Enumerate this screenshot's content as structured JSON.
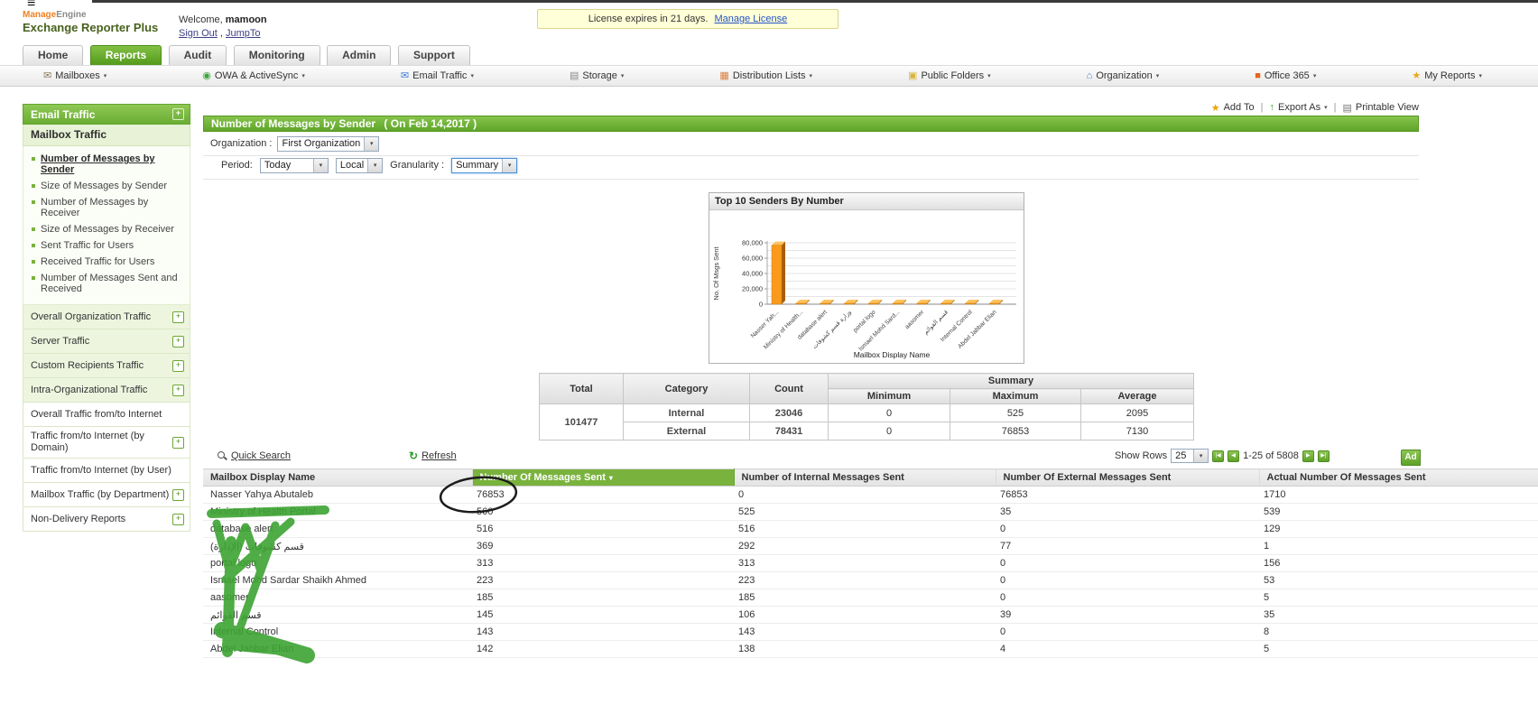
{
  "chrome": {
    "hamburger": "≡"
  },
  "header": {
    "brand_manage": "Manage",
    "brand_engine": "Engine",
    "product": "Exchange Reporter Plus",
    "welcome_prefix": "Welcome,",
    "username": "mamoon",
    "sign_out": "Sign Out",
    "comma": ",",
    "jump_to": "JumpTo",
    "license_text": "License expires in 21 days.",
    "license_link": "Manage License"
  },
  "tabs": [
    {
      "label": "Home",
      "active": false
    },
    {
      "label": "Reports",
      "active": true
    },
    {
      "label": "Audit",
      "active": false
    },
    {
      "label": "Monitoring",
      "active": false
    },
    {
      "label": "Admin",
      "active": false
    },
    {
      "label": "Support",
      "active": false
    }
  ],
  "nav_items": [
    {
      "label": "Mailboxes",
      "icon": "mailboxes-icon",
      "glyph": "✉",
      "color": "#8a7b5c"
    },
    {
      "label": "OWA & ActiveSync",
      "icon": "owa-activesync-icon",
      "glyph": "◉",
      "color": "#3fa43f"
    },
    {
      "label": "Email Traffic",
      "icon": "email-traffic-icon",
      "glyph": "✉",
      "color": "#3f7fd9"
    },
    {
      "label": "Storage",
      "icon": "storage-icon",
      "glyph": "▤",
      "color": "#8a8a8a"
    },
    {
      "label": "Distribution Lists",
      "icon": "distribution-lists-icon",
      "glyph": "▦",
      "color": "#d9823f"
    },
    {
      "label": "Public Folders",
      "icon": "public-folders-icon",
      "glyph": "▣",
      "color": "#d9b43f"
    },
    {
      "label": "Organization",
      "icon": "organization-icon",
      "glyph": "⌂",
      "color": "#3f7fd9"
    },
    {
      "label": "Office 365",
      "icon": "office-365-icon",
      "glyph": "■",
      "color": "#e8641b"
    },
    {
      "label": "My Reports",
      "icon": "my-reports-icon",
      "glyph": "★",
      "color": "#e8a81b"
    }
  ],
  "sidebar": {
    "header": "Email Traffic",
    "group": "Mailbox Traffic",
    "items": [
      {
        "label": "Number of Messages by Sender",
        "active": true
      },
      {
        "label": "Size of Messages by Sender",
        "active": false
      },
      {
        "label": "Number of Messages by Receiver",
        "active": false
      },
      {
        "label": "Size of Messages by Receiver",
        "active": false
      },
      {
        "label": "Sent Traffic for Users",
        "active": false
      },
      {
        "label": "Received Traffic for Users",
        "active": false
      },
      {
        "label": "Number of Messages Sent and Received",
        "active": false
      }
    ],
    "sections": [
      {
        "label": "Overall Organization Traffic",
        "tint": true,
        "expand": true
      },
      {
        "label": "Server Traffic",
        "tint": true,
        "expand": true
      },
      {
        "label": "Custom Recipients Traffic",
        "tint": true,
        "expand": true
      },
      {
        "label": "Intra-Organizational Traffic",
        "tint": true,
        "expand": true
      },
      {
        "label": "Overall Traffic from/to Internet",
        "tint": false,
        "expand": false
      },
      {
        "label": "Traffic from/to Internet (by Domain)",
        "tint": false,
        "expand": true
      },
      {
        "label": "Traffic from/to Internet (by User)",
        "tint": false,
        "expand": false
      },
      {
        "label": "Mailbox Traffic (by Department)",
        "tint": false,
        "expand": true
      },
      {
        "label": "Non-Delivery Reports",
        "tint": false,
        "expand": true
      }
    ]
  },
  "actions": {
    "add_to": "Add To",
    "export_as": "Export As",
    "printable_view": "Printable View",
    "sep": "|"
  },
  "report": {
    "title": "Number of Messages by Sender",
    "date": "( On Feb 14,2017 )",
    "organization_label": "Organization :",
    "organization_value": "First Organization",
    "period_label": "Period:",
    "period_value": "Today",
    "tz_value": "Local",
    "granularity_label": "Granularity :",
    "granularity_value": "Summary"
  },
  "chart_data": {
    "type": "bar",
    "title": "Top 10 Senders By Number",
    "xlabel": "Mailbox Display Name",
    "ylabel": "No. Of Msgs Sent",
    "ylim": [
      0,
      80000
    ],
    "yticks": [
      0,
      20000,
      40000,
      60000,
      80000
    ],
    "grid": true,
    "legend": "none",
    "categories": [
      "Nasser Yah...",
      "Ministry of Health...",
      "database alert",
      "وزارة قسم كشوفات",
      "portal logo",
      "Ismael Mohd Sard...",
      "aasomer",
      "قسم القوائم",
      "Internal Control",
      "Abdel Jabbar Elian"
    ],
    "values": [
      76853,
      560,
      516,
      369,
      313,
      223,
      185,
      145,
      143,
      142
    ]
  },
  "summary_table": {
    "headers": {
      "total": "Total",
      "category": "Category",
      "count": "Count",
      "summary": "Summary",
      "minimum": "Minimum",
      "maximum": "Maximum",
      "average": "Average"
    },
    "total": "101477",
    "rows": [
      {
        "category": "Internal",
        "count": "23046",
        "min": "0",
        "max": "525",
        "avg": "2095"
      },
      {
        "category": "External",
        "count": "78431",
        "min": "0",
        "max": "76853",
        "avg": "7130"
      }
    ]
  },
  "toolbar": {
    "quick_search": "Quick Search",
    "refresh": "Refresh",
    "show_rows_label": "Show Rows",
    "show_rows_value": "25",
    "range": "1-25 of 5808",
    "add_cut": "Ad"
  },
  "table": {
    "columns": [
      "Mailbox Display Name",
      "Number Of Messages Sent",
      "Number of Internal Messages Sent",
      "Number Of External Messages Sent",
      "Actual Number Of Messages Sent"
    ],
    "rows": [
      {
        "name": "Nasser Yahya Abutaleb",
        "sent": "76853",
        "internal": "0",
        "external": "76853",
        "actual": "1710"
      },
      {
        "name": "Ministry of Health Portal",
        "sent": "560",
        "internal": "525",
        "external": "35",
        "actual": "539"
      },
      {
        "name": "database alert",
        "sent": "516",
        "internal": "516",
        "external": "0",
        "actual": "129"
      },
      {
        "name": "قسم كشوفات (الإدارة)",
        "sent": "369",
        "internal": "292",
        "external": "77",
        "actual": "1"
      },
      {
        "name": "portal logo",
        "sent": "313",
        "internal": "313",
        "external": "0",
        "actual": "156"
      },
      {
        "name": "Ismael Mohd Sardar Shaikh Ahmed",
        "sent": "223",
        "internal": "223",
        "external": "0",
        "actual": "53"
      },
      {
        "name": "aasomer",
        "sent": "185",
        "internal": "185",
        "external": "0",
        "actual": "5"
      },
      {
        "name": "قسم القوائم",
        "sent": "145",
        "internal": "106",
        "external": "39",
        "actual": "35"
      },
      {
        "name": "Internal Control",
        "sent": "143",
        "internal": "143",
        "external": "0",
        "actual": "8"
      },
      {
        "name": "Abdel Jabbar Elian",
        "sent": "142",
        "internal": "138",
        "external": "4",
        "actual": "5"
      }
    ]
  },
  "annotations": {
    "circle_color": "#1c1c1c",
    "marker_color": "#3da432"
  },
  "icons": {
    "dropdown": "▾",
    "sort_desc": "▾",
    "star": "★",
    "refresh": "↻",
    "export_arrow": "↑",
    "printer": "▤",
    "plus": "+",
    "first": "|◀",
    "prev": "◀",
    "next": "▶",
    "last": "▶|"
  }
}
